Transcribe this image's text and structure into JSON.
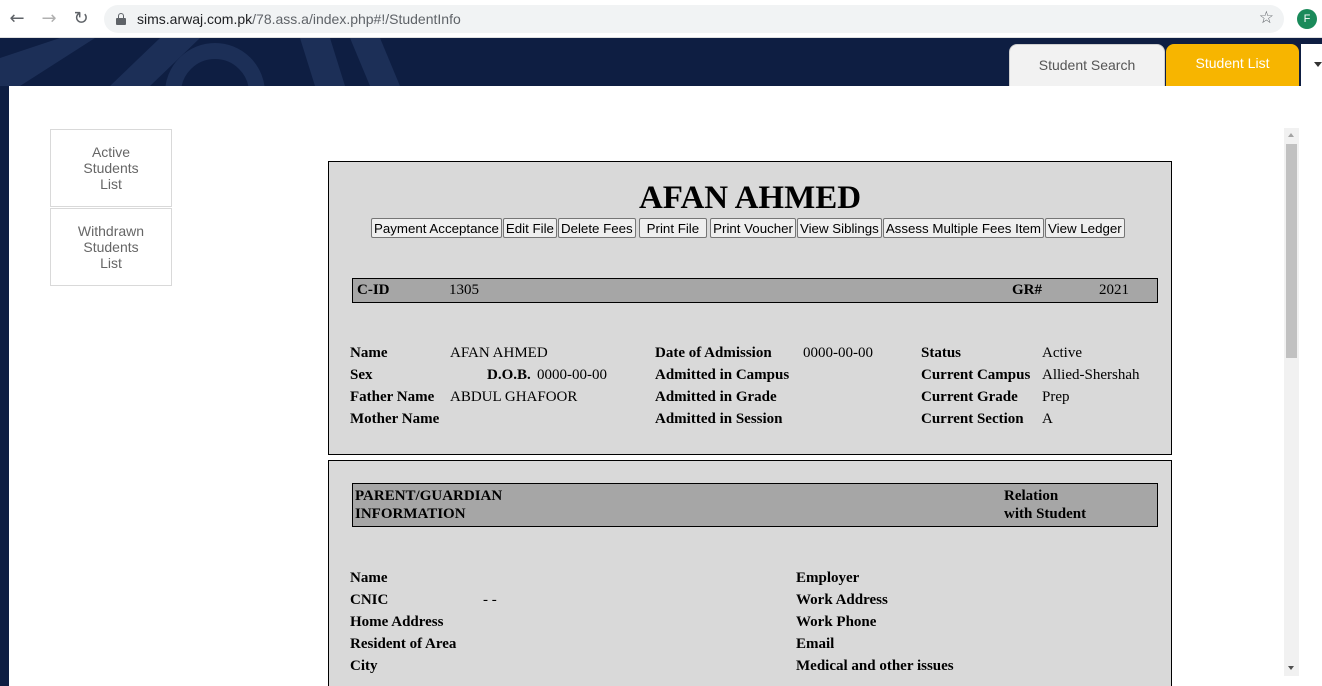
{
  "browser": {
    "url_host": "sims.arwaj.com.pk",
    "url_path": "/78.ass.a/index.php#!/StudentInfo",
    "profile_initial": "F"
  },
  "header": {
    "tabs": [
      {
        "label": "Student Search",
        "active": false
      },
      {
        "label": "Student List",
        "active": true
      }
    ],
    "accent_color": "#f7b500",
    "bar_color": "#0e1e42"
  },
  "sidebar": {
    "items": [
      {
        "label": "Active Students List"
      },
      {
        "label": "Withdrawn Students List"
      }
    ]
  },
  "student": {
    "name": "AFAN AHMED",
    "actions": [
      "Payment Acceptance",
      "Edit File",
      "Delete Fees",
      "Print File",
      "Print Voucher",
      "View Siblings",
      "Assess Multiple Fees Item",
      "View Ledger"
    ],
    "cid_label": "C-ID",
    "cid_value": "1305",
    "gr_label": "GR#",
    "gr_value": "2021",
    "fields": {
      "name_label": "Name",
      "name_value": "AFAN AHMED",
      "sex_label": "Sex",
      "sex_value": "",
      "dob_label": "D.O.B.",
      "dob_value": "0000-00-00",
      "father_label": "Father Name",
      "father_value": "ABDUL GHAFOOR",
      "mother_label": "Mother Name",
      "mother_value": "",
      "doa_label": "Date of Admission",
      "doa_value": "0000-00-00",
      "adm_campus_label": "Admitted in Campus",
      "adm_campus_value": "",
      "adm_grade_label": "Admitted in Grade",
      "adm_grade_value": "",
      "adm_session_label": "Admitted in Session",
      "adm_session_value": "",
      "status_label": "Status",
      "status_value": "Active",
      "cur_campus_label": "Current Campus",
      "cur_campus_value": "Allied-Shershah",
      "cur_grade_label": "Current Grade",
      "cur_grade_value": "Prep",
      "cur_section_label": "Current Section",
      "cur_section_value": "A"
    }
  },
  "guardian": {
    "header_line1": "PARENT/GUARDIAN",
    "header_line2": "INFORMATION",
    "relation_line1": "Relation",
    "relation_line2": "with Student",
    "fields": {
      "name_label": "Name",
      "cnic_label": "CNIC",
      "cnic_value": "- -",
      "home_label": "Home Address",
      "resident_label": "Resident of Area",
      "city_label": "City",
      "employer_label": "Employer",
      "work_address_label": "Work Address",
      "work_phone_label": "Work Phone",
      "email_label": "Email",
      "medical_label": "Medical and other issues"
    }
  }
}
